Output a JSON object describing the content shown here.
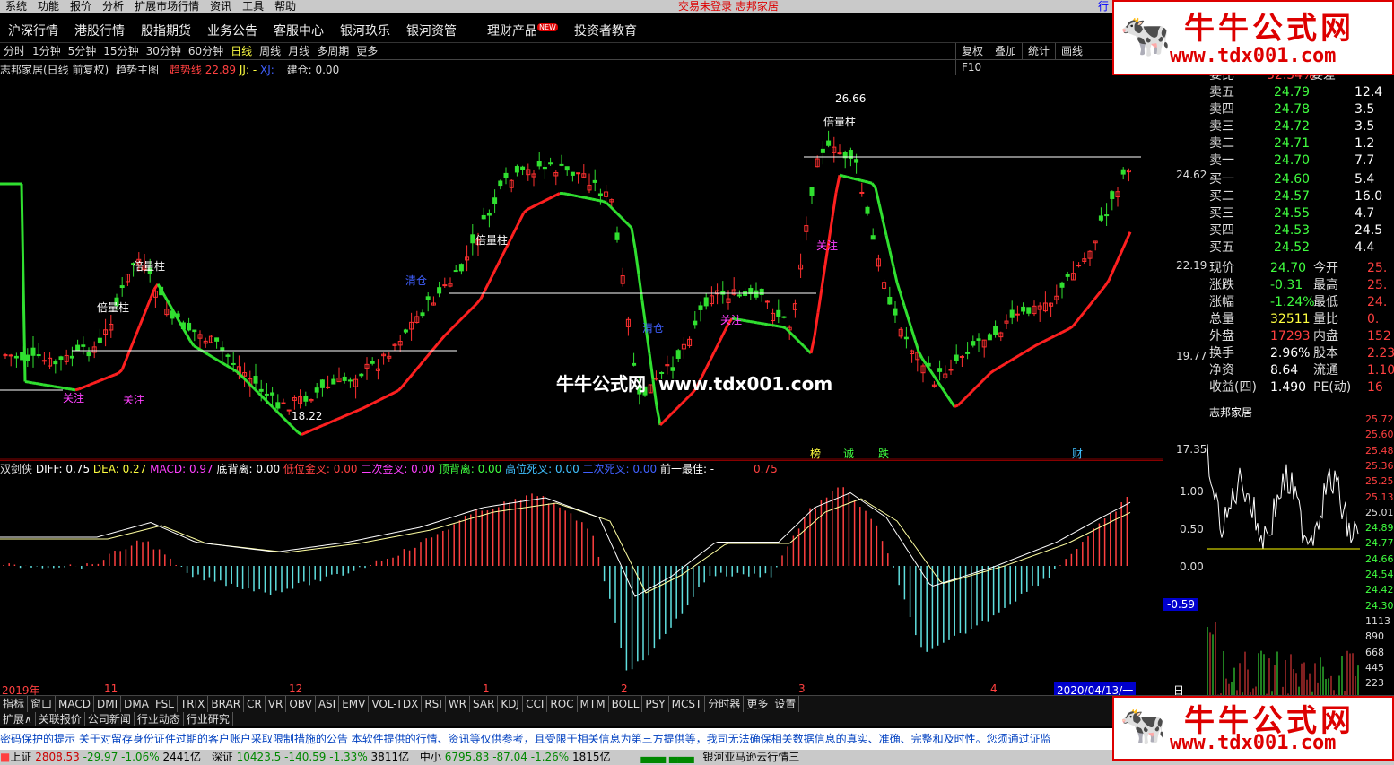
{
  "menu": [
    "系统",
    "功能",
    "报价",
    "分析",
    "扩展市场行情",
    "资讯",
    "工具",
    "帮助"
  ],
  "login_status": "交易未登录 志邦家居",
  "nav": [
    "沪深行情",
    "港股行情",
    "股指期货",
    "业务公告",
    "客服中心",
    "银河玖乐",
    "银河资管",
    "理财产品",
    "投资者教育"
  ],
  "nav_badge": "NEW",
  "periods": [
    "分时",
    "1分钟",
    "5分钟",
    "15分钟",
    "30分钟",
    "60分钟",
    "日线",
    "周线",
    "月线",
    "多周期",
    "更多"
  ],
  "toolbar_right": [
    "复权",
    "叠加",
    "统计",
    "画线",
    "F10"
  ],
  "chart_header": {
    "stock": "志邦家居(日线 前复权)",
    "indicator": "趋势主图",
    "qsx_label": "趋势线",
    "qsx_value": "22.89",
    "jj": "JJ: -",
    "xj": "XJ:",
    "jc": "建仓: 0.00"
  },
  "price_axis": [
    "24.62",
    "22.19",
    "19.77",
    "17.35"
  ],
  "annotations": {
    "beiliangzhu": "倍量柱",
    "guanzhu": "关注",
    "qingcang": "清仓",
    "high": "26.66",
    "low": "18.22",
    "signals": [
      "榜",
      "诚",
      "跌",
      "财"
    ]
  },
  "watermark": "牛牛公式网  www.tdx001.com",
  "macd_header": {
    "name": "双剑侠",
    "diff": "DIFF: 0.75",
    "dea": "DEA: 0.27",
    "macd": "MACD: 0.97",
    "dbl": "底背离: 0.00",
    "dwjc": "低位金叉: 0.00",
    "ecjc": "二次金叉: 0.00",
    "dbl2": "顶背离: 0.00",
    "gwsc": "高位死叉: 0.00",
    "ecsc": "二次死叉: 0.00",
    "qyzj": "前一最佳: -",
    "extra": "0.75"
  },
  "macd_axis": [
    "1.00",
    "0.50",
    "0.00"
  ],
  "macd_cursor": "-0.59",
  "date_axis": [
    "2019年",
    "11",
    "12",
    "1",
    "2",
    "3",
    "4"
  ],
  "date_box": "2020/04/13/一",
  "period_label": "日线",
  "quote": {
    "wb_label": "委比",
    "wb_value": "32.54%",
    "wc_label": "委差",
    "asks": [
      {
        "label": "卖五",
        "price": "24.79",
        "vol": "12.4"
      },
      {
        "label": "卖四",
        "price": "24.78",
        "vol": "3.5"
      },
      {
        "label": "卖三",
        "price": "24.72",
        "vol": "3.5"
      },
      {
        "label": "卖二",
        "price": "24.71",
        "vol": "1.2"
      },
      {
        "label": "卖一",
        "price": "24.70",
        "vol": "7.7"
      }
    ],
    "bids": [
      {
        "label": "买一",
        "price": "24.60",
        "vol": "5.4"
      },
      {
        "label": "买二",
        "price": "24.57",
        "vol": "16.0"
      },
      {
        "label": "买三",
        "price": "24.55",
        "vol": "4.7"
      },
      {
        "label": "买四",
        "price": "24.53",
        "vol": "24.5"
      },
      {
        "label": "买五",
        "price": "24.52",
        "vol": "4.4"
      }
    ],
    "stats": [
      {
        "l1": "现价",
        "v1": "24.70",
        "l2": "今开",
        "v2": "25."
      },
      {
        "l1": "涨跌",
        "v1": "-0.31",
        "l2": "最高",
        "v2": "25."
      },
      {
        "l1": "涨幅",
        "v1": "-1.24%",
        "l2": "最低",
        "v2": "24."
      },
      {
        "l1": "总量",
        "v1": "32511",
        "l2": "量比",
        "v2": "0."
      },
      {
        "l1": "外盘",
        "v1": "17293",
        "l2": "内盘",
        "v2": "152"
      },
      {
        "l1": "换手",
        "v1": "2.96%",
        "l2": "股本",
        "v2": "2.23"
      },
      {
        "l1": "净资",
        "v1": "8.64",
        "l2": "流通",
        "v2": "1.10"
      },
      {
        "l1": "收益(四)",
        "v1": "1.490",
        "l2": "PE(动)",
        "v2": "16"
      }
    ]
  },
  "mini_chart": {
    "title": "志邦家居",
    "axis": [
      "25.72",
      "25.60",
      "25.48",
      "25.36",
      "25.25",
      "25.13",
      "25.01",
      "24.89",
      "24.77",
      "24.66",
      "24.54",
      "24.42",
      "24.30",
      "1113",
      "890",
      "668",
      "445",
      "223"
    ]
  },
  "bottom_tabs": [
    "指标",
    "窗口",
    "MACD",
    "DMI",
    "DMA",
    "FSL",
    "TRIX",
    "BRAR",
    "CR",
    "VR",
    "OBV",
    "ASI",
    "EMV",
    "VOL-TDX",
    "RSI",
    "WR",
    "SAR",
    "KDJ",
    "CCI",
    "ROC",
    "MTM",
    "BOLL",
    "PSY",
    "MCST",
    "分时器",
    "更多",
    "设置"
  ],
  "ext_tabs": [
    "扩展∧",
    "关联报价",
    "公司新闻",
    "行业动态",
    "行业研究"
  ],
  "news": "密码保护的提示      关于对留存身份证件过期的客户账户采取限制措施的公告           本软件提供的行情、资讯等仅供参考，且受限于相关信息为第三方提供等，我司无法确保相关数据信息的真实、准确、完整和及时性。您须通过证监",
  "status": {
    "sh": "上证",
    "sh_v": "2808.53",
    "sh_c": "-29.97",
    "sh_p": "-1.06%",
    "sh_a": "2441亿",
    "sz": "深证",
    "sz_v": "10423.5",
    "sz_c": "-140.59",
    "sz_p": "-1.33%",
    "sz_a": "3811亿",
    "zx": "中小",
    "zx_v": "6795.83",
    "zx_c": "-87.04",
    "zx_p": "-1.26%",
    "zx_a": "1815亿",
    "server": "银河亚马逊云行情三"
  },
  "logo": {
    "line1": "牛牛公式网",
    "line2": "www.tdx001.com"
  },
  "right_tab": "行"
}
